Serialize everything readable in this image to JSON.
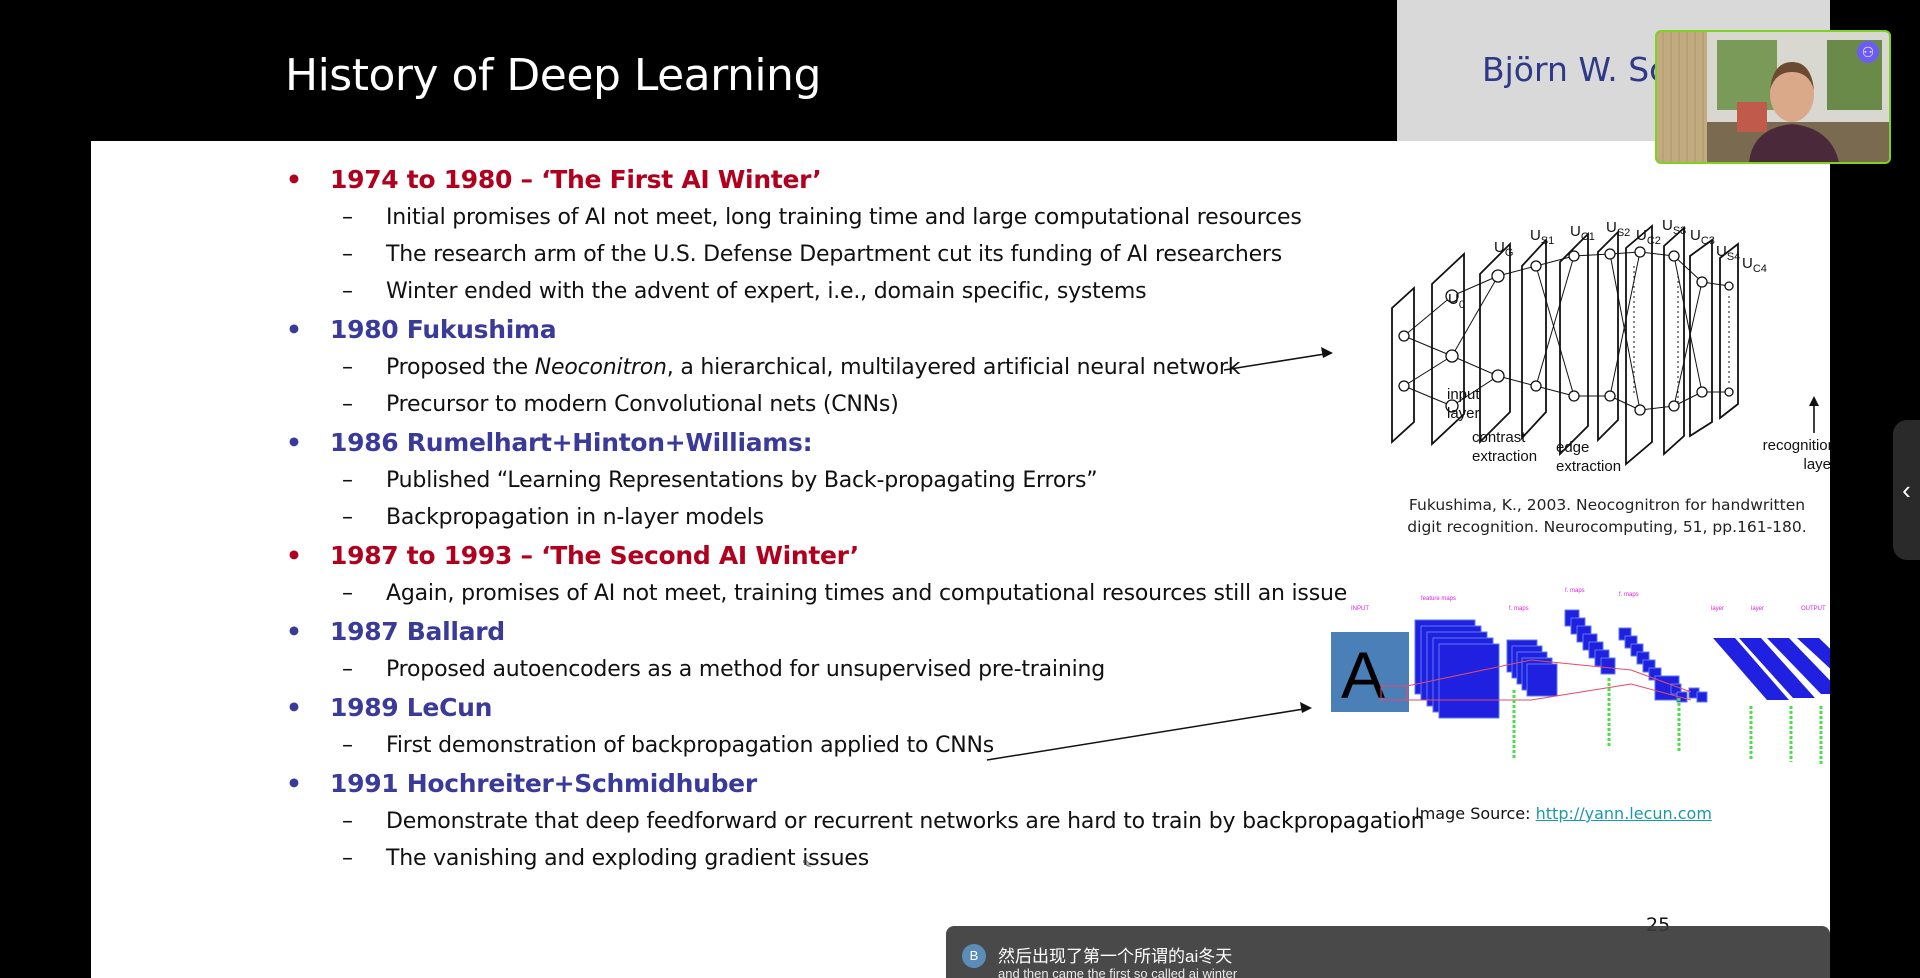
{
  "slide": {
    "title": "History of Deep Learning",
    "author": "Björn W. Sc",
    "number": "25",
    "items": [
      {
        "heading": "1974 to 1980 – ‘The First AI Winter’",
        "color": "red",
        "subs": [
          {
            "text": "Initial promises of AI not meet, long training time and large computational resources"
          },
          {
            "text": "The research arm of the U.S. Defense Department cut its funding of AI researchers"
          },
          {
            "text": "Winter ended with the advent of expert, i.e., domain specific, systems"
          }
        ]
      },
      {
        "heading": "1980 Fukushima",
        "color": "blue",
        "subs": [
          {
            "pre": "Proposed the ",
            "em": "Neoconitron",
            "post": ", a hierarchical, multilayered artificial neural network"
          },
          {
            "text": "Precursor to modern Convolutional nets (CNNs)"
          }
        ]
      },
      {
        "heading": "1986 Rumelhart+Hinton+Williams:",
        "color": "blue",
        "subs": [
          {
            "text": "Published “Learning Representations by Back-propagating Errors”"
          },
          {
            "text": "Backpropagation in n-layer models"
          }
        ]
      },
      {
        "heading": "1987 to 1993 – ‘The Second AI Winter’",
        "color": "red",
        "subs": [
          {
            "text": "Again, promises of AI not meet, training times and computational resources still an issue"
          }
        ]
      },
      {
        "heading": "1987 Ballard",
        "color": "blue",
        "subs": [
          {
            "text": "Proposed autoencoders as a method for unsupervised pre-training"
          }
        ]
      },
      {
        "heading": "1989 LeCun",
        "color": "blue",
        "subs": [
          {
            "text": "First demonstration of backpropagation applied to CNNs"
          }
        ]
      },
      {
        "heading": "1991 Hochreiter+Schmidhuber",
        "color": "blue",
        "subs": [
          {
            "text": "Demonstrate that deep feedforward or recurrent networks are hard to train by backpropagation"
          },
          {
            "text": "The vanishing and exploding gradient issues"
          }
        ]
      }
    ],
    "bullet_glyph": "•",
    "dash_glyph": "–",
    "neocognitron_figure": {
      "label_u0": "U",
      "label_u0_sub": "0",
      "label_ug": "U",
      "label_ug_sub": "G",
      "layer_labels": [
        {
          "main": "U",
          "sub": "S1"
        },
        {
          "main": "U",
          "sub": "C1"
        },
        {
          "main": "U",
          "sub": "S2"
        },
        {
          "main": "U",
          "sub": "C2"
        },
        {
          "main": "U",
          "sub": "S3"
        },
        {
          "main": "U",
          "sub": "C3"
        },
        {
          "main": "U",
          "sub": "S4"
        },
        {
          "main": "U",
          "sub": "C4"
        }
      ],
      "input_layer": [
        "input",
        "layer"
      ],
      "contrast": [
        "contrast",
        "extraction"
      ],
      "edge": [
        "edge",
        "extraction"
      ],
      "recognition": [
        "recognition",
        "layer"
      ],
      "caption_line1": "Fukushima, K., 2003. Neocognitron for handwritten",
      "caption_line2": "digit recognition. Neurocomputing, 51, pp.161-180."
    },
    "lenet_figure": {
      "input_letter": "A",
      "tiny_labels": [
        "INPUT",
        "feature maps",
        "f. maps",
        "f. maps",
        "f. maps",
        "layer",
        "layer",
        "OUTPUT"
      ]
    },
    "image_source_label": "Image Source: ",
    "image_source_link": "http://yann.lecun.com"
  },
  "overlay": {
    "webcam_badge": "⚇",
    "side_tab_icon": "‹",
    "subtitle_avatar": "B",
    "subtitle_zh": "然后出现了第一个所谓的ai冬天",
    "subtitle_en": "and then came the first so called ai winter",
    "cursor_glyph": "✎"
  }
}
